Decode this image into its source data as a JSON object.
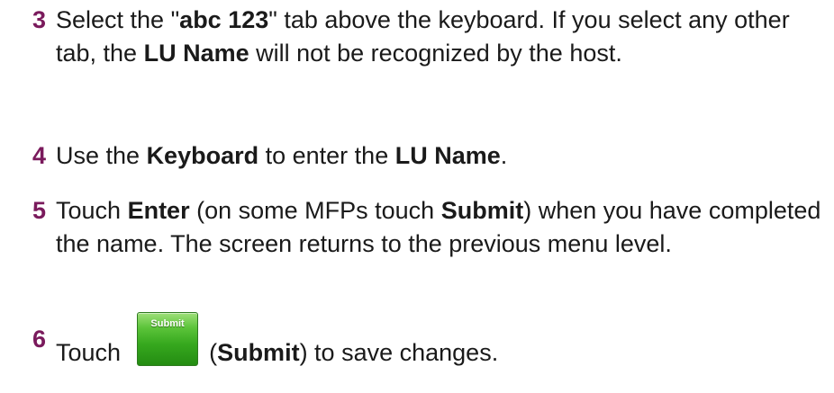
{
  "steps": [
    {
      "number": "3",
      "t1": "Select the \"",
      "b1": "abc 123",
      "t2": "\" tab above the keyboard. If you select any other tab, the ",
      "b2": "LU Name",
      "t3": " will not be recognized by the host."
    },
    {
      "number": "4",
      "t1": "Use the ",
      "b1": "Keyboard",
      "t2": " to enter the ",
      "b2": "LU Name",
      "t3": "."
    },
    {
      "number": "5",
      "t1": "Touch ",
      "b1": "Enter",
      "t2": " (on some MFPs touch ",
      "b2": "Submit",
      "t3": ") when you have completed the name. The screen returns to the previous menu level."
    },
    {
      "number": "6",
      "t1": "Touch",
      "button_label": "Submit",
      "t2": "(",
      "b1": "Submit",
      "t3": ") to save changes."
    }
  ],
  "colors": {
    "step_number": "#7a1a5c",
    "body_text": "#1a1a1a",
    "button_green": "#36a81e"
  }
}
